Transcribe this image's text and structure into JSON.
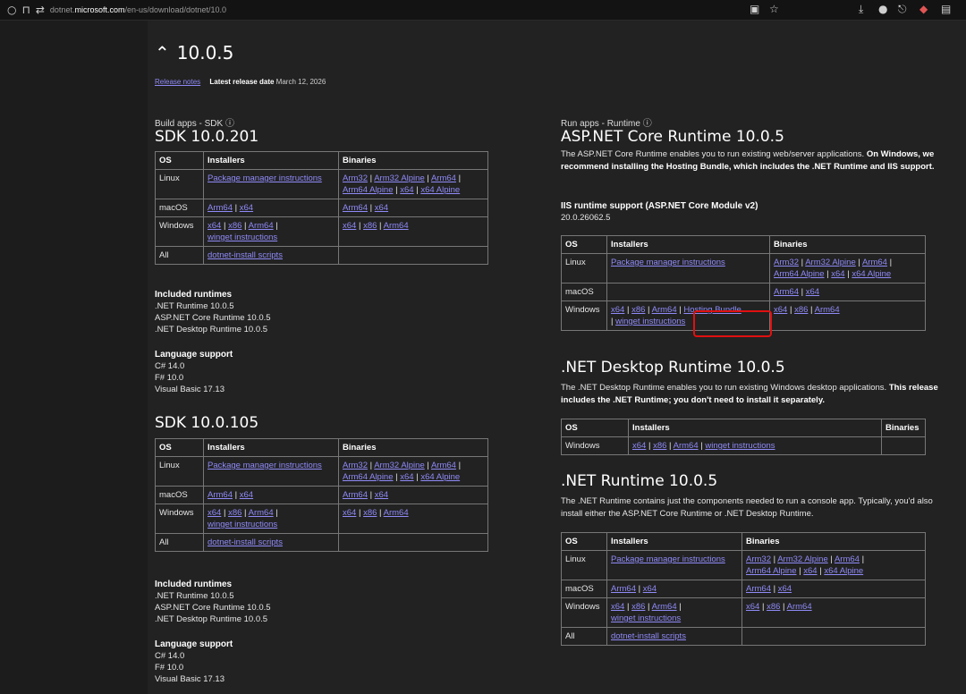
{
  "browser": {
    "url_prefix": "dotnet.",
    "url_domain": "microsoft.com",
    "url_path": "/en-us/download/dotnet/10.0"
  },
  "version": {
    "title": "10.0.5",
    "release_notes": "Release notes",
    "release_date_label": "Latest release date",
    "release_date": "March 12, 2026"
  },
  "left_col": {
    "section_label": "Build apps - SDK",
    "sdk1": {
      "title": "SDK 10.0.201",
      "headers": [
        "OS",
        "Installers",
        "Binaries"
      ],
      "linux": {
        "os": "Linux",
        "installer": "Package manager instructions",
        "bin1": "Arm32",
        "bin2": "Arm32 Alpine",
        "bin3": "Arm64",
        "bin4": "Arm64 Alpine",
        "bin5": "x64",
        "bin6": "x64 Alpine"
      },
      "macos": {
        "os": "macOS",
        "inst1": "Arm64",
        "inst2": "x64",
        "bin1": "Arm64",
        "bin2": "x64"
      },
      "windows": {
        "os": "Windows",
        "inst1": "x64",
        "inst2": "x86",
        "inst3": "Arm64",
        "inst4": "winget instructions",
        "bin1": "x64",
        "bin2": "x86",
        "bin3": "Arm64"
      },
      "all": {
        "os": "All",
        "installer": "dotnet-install scripts"
      },
      "included_hd": "Included runtimes",
      "included": [
        ".NET Runtime 10.0.5",
        "ASP.NET Core Runtime 10.0.5",
        ".NET Desktop Runtime 10.0.5"
      ],
      "lang_hd": "Language support",
      "lang": [
        "C# 14.0",
        "F# 10.0",
        "Visual Basic 17.13"
      ]
    },
    "sdk2": {
      "title": "SDK 10.0.105",
      "headers": [
        "OS",
        "Installers",
        "Binaries"
      ],
      "linux": {
        "os": "Linux",
        "installer": "Package manager instructions",
        "bin1": "Arm32",
        "bin2": "Arm32 Alpine",
        "bin3": "Arm64",
        "bin4": "Arm64 Alpine",
        "bin5": "x64",
        "bin6": "x64 Alpine"
      },
      "macos": {
        "os": "macOS",
        "inst1": "Arm64",
        "inst2": "x64",
        "bin1": "Arm64",
        "bin2": "x64"
      },
      "windows": {
        "os": "Windows",
        "inst1": "x64",
        "inst2": "x86",
        "inst3": "Arm64",
        "inst4": "winget instructions",
        "bin1": "x64",
        "bin2": "x86",
        "bin3": "Arm64"
      },
      "all": {
        "os": "All",
        "installer": "dotnet-install scripts"
      },
      "included_hd": "Included runtimes",
      "included": [
        ".NET Runtime 10.0.5",
        "ASP.NET Core Runtime 10.0.5",
        ".NET Desktop Runtime 10.0.5"
      ],
      "lang_hd": "Language support",
      "lang": [
        "C# 14.0",
        "F# 10.0",
        "Visual Basic 17.13"
      ]
    }
  },
  "right_col": {
    "section_label": "Run apps - Runtime",
    "aspnet": {
      "title": "ASP.NET Core Runtime 10.0.5",
      "desc_plain": "The ASP.NET Core Runtime enables you to run existing web/server applications.",
      "desc_bold": "On Windows, we recommend installing the Hosting Bundle, which includes the .NET Runtime and IIS support.",
      "iis_hd": "IIS runtime support (ASP.NET Core Module v2)",
      "iis_ver": "20.0.26062.5",
      "headers": [
        "OS",
        "Installers",
        "Binaries"
      ],
      "linux": {
        "os": "Linux",
        "installer": "Package manager instructions",
        "bin1": "Arm32",
        "bin2": "Arm32 Alpine",
        "bin3": "Arm64",
        "bin4": "Arm64 Alpine",
        "bin5": "x64",
        "bin6": "x64 Alpine"
      },
      "macos": {
        "os": "macOS",
        "bin1": "Arm64",
        "bin2": "x64"
      },
      "windows": {
        "os": "Windows",
        "inst1": "x64",
        "inst2": "x86",
        "inst3": "Arm64",
        "inst4": "Hosting Bundle",
        "inst5": "winget instructions",
        "bin1": "x64",
        "bin2": "x86",
        "bin3": "Arm64"
      }
    },
    "desktop": {
      "title": ".NET Desktop Runtime 10.0.5",
      "desc_plain": "The .NET Desktop Runtime enables you to run existing Windows desktop applications.",
      "desc_bold": "This release includes the .NET Runtime; you don't need to install it separately.",
      "headers": [
        "OS",
        "Installers",
        "Binaries"
      ],
      "windows": {
        "os": "Windows",
        "inst1": "x64",
        "inst2": "x86",
        "inst3": "Arm64",
        "inst4": "winget instructions"
      }
    },
    "runtime": {
      "title": ".NET Runtime 10.0.5",
      "desc": "The .NET Runtime contains just the components needed to run a console app. Typically, you'd also install either the ASP.NET Core Runtime or .NET Desktop Runtime.",
      "headers": [
        "OS",
        "Installers",
        "Binaries"
      ],
      "linux": {
        "os": "Linux",
        "installer": "Package manager instructions",
        "bin1": "Arm32",
        "bin2": "Arm32 Alpine",
        "bin3": "Arm64",
        "bin4": "Arm64 Alpine",
        "bin5": "x64",
        "bin6": "x64 Alpine"
      },
      "macos": {
        "os": "macOS",
        "inst1": "Arm64",
        "inst2": "x64",
        "bin1": "Arm64",
        "bin2": "x64"
      },
      "windows": {
        "os": "Windows",
        "inst1": "x64",
        "inst2": "x86",
        "inst3": "Arm64",
        "inst4": "winget instructions",
        "bin1": "x64",
        "bin2": "x86",
        "bin3": "Arm64"
      },
      "all": {
        "os": "All",
        "installer": "dotnet-install scripts"
      }
    }
  },
  "colors": {
    "link": "#8f8af7",
    "background": "#222222",
    "highlight": "#e01010"
  }
}
